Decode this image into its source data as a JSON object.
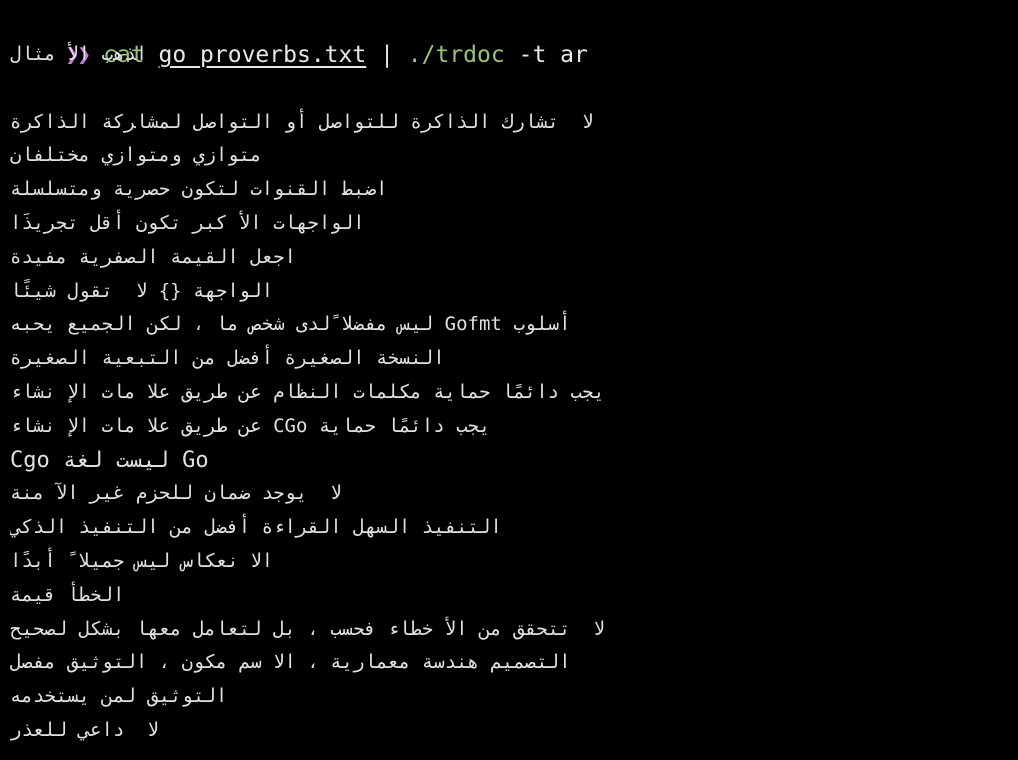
{
  "terminal": {
    "prompt_symbol": "❯❯",
    "command": {
      "program": "cat",
      "file": "go_proverbs.txt",
      "pipe": "|",
      "tool": "./trdoc",
      "flags": "-t ar"
    },
    "output_lines": [
      "ﻝﺎﺜﻣ ﻷﺍ ﺏﻫﺬﺍ",
      "",
      "ﺓﺮﻛﺍﺬﻟﺍ ﺔﻛﺮﺎﺸﻤﻟ ﻞﺻﺍﻮﺘﻟﺍ ﻭﺃ ﻞﺻﺍﻮﺘﻠﻟ ﺓﺮﻛﺍﺬﻟﺍ ﻙﺭﺎﺸﺗ  ﻻ",
      "ﻥﺎﻔﻠﺘﺨﻣ ﻱﺯﺍﻮﺘﻣﻭ ﻱﺯﺍﻮﺘﻣ",
      "ﺔﻠﺴﻠﺴﺘﻣﻭ ﺔﻳﺮﺼﺣ ﻥﻮﻜﺘﻟ ﺕﺍﻮﻨﻘﻟﺍ ﻂﺒﺿﺍ",
      "ﺍﺬَﻳﺮﺠﺗ ﻞﻗﺃ ﻥﻮﻜﺗ ﺮﺒﻛ ﻷﺍ ﺕﺎﻬﺟﺍﻮﻟﺍ",
      "ﺓﺪﻴﻔﻣ ﺔﻳﺮﻔﺼﻟﺍ ﺔﻤﻴﻘﻟﺍ ﻞﻌﺟﺍ",
      "ﺎﺌًﻴﺷ ﻝﻮﻘﺗ  ﻻ {} ﺔﻬﺟﺍﻮﻟﺍ",
      "ﻪﺒﺤﻳ ﻊﻴﻤﺠﻟﺍ ﻦﻜﻟ ، ﺎﻣ ﺺﺨﺷ ﻯﺪﻟ ًﻼﻀﻔﻣ ﺲﻴﻟ Gofmt ﺏﻮﻠﺳﺃ",
      "ﺓﺮﻴﻐﺼﻟﺍ ﺔﻴﻌﺒﺘﻟﺍ ﻦﻣ ﻞﻀﻓﺃ ﺓﺮﻴﻐﺼﻟﺍ ﺔﺨﺴﻨﻟﺍ",
      "ءﺎﺸﻧ ﻹﺍ ﺕﺎﻣ ﻼﻋ ﻖﻳﺮﻃ ﻦﻋ ﻡﺎﻈﻨﻟﺍ ﺕﺎﻤﻠﻜﻣ ﺔﻳﺎﻤﺣ ﺎﻤًﺋﺍﺩ ﺐﺠﻳ",
      "ءﺎﺸﻧ ﻹﺍ ﺕﺎﻣ ﻼﻋ ﻖﻳﺮﻃ ﻦﻋ CGo ﺔﻳﺎﻤﺣ ﺎﻤًﺋﺍﺩ ﺐﺠﻳ",
      "Cgo ﺔﻐﻟ ﺖﺴﻴﻟ Go",
      "ﺔﻨﻣ ﻵﺍ ﺮﻴﻏ ﻡﺰﺤﻠﻟ ﻥﺎﻤﺿ ﺪﺟﻮﻳ  ﻻ",
      "ﻲﻛﺬﻟﺍ ﺬﻴﻔﻨﺘﻟﺍ ﻦﻣ ﻞﻀﻓﺃ ﺓءﺍﺮﻘﻟﺍ ﻞﻬﺴﻟﺍ ﺬﻴﻔﻨﺘﻟﺍ",
      "ﺍﺪًﺑﺃ  ًﻼﻴﻤﺟ ﺲﻴﻟ ﺱﺎﻜﻌﻧ ﻻﺍ",
      "ﺔﻤﻴﻗ ﺄﻄﺨﻟﺍ",
      "ﺢﻴﺤﺼﻟ ﻞﻜﺸﺑ ﺎﻬﻌﻣ ﻞﻣﺎﻌﺘﻟ ﻞﺑ ، ﺐﺴﺤﻓ ءﺎﻄﺧ ﻷﺍ ﻦﻣ ﻖﻘﺤﺘﺗ  ﻻ",
      "ﻞﺼﻔﻣ ﻖﻴﺛﻮﺘﻟﺍ ، ﻥﻮﻜﻣ ﻢﺳ ﻻﺍ ، ﺔﻳﺭﺎﻤﻌﻣ ﺔﺳﺪﻨﻫ ﻢﻴﻤﺼﺘﻟﺍ",
      "ﻪﻣﺪﺨﺘﺴﻳ ﻦﻤﻟ ﻖﻴﺛﻮﺘﻟﺍ",
      "ﺭﺬﻌﻠﻟ ﻲﻋﺍﺩ  ﻻ"
    ]
  }
}
